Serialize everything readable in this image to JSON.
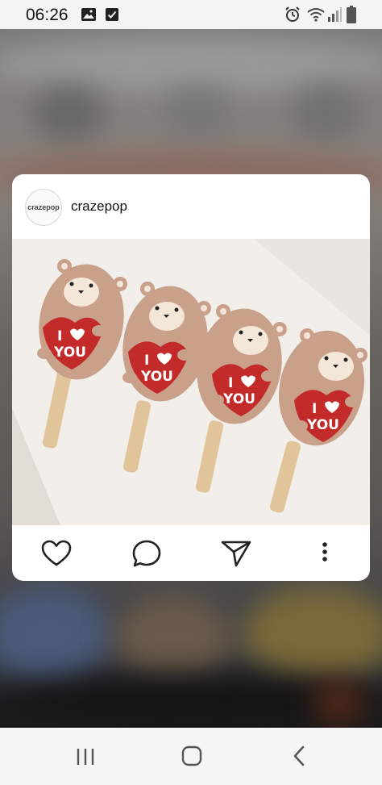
{
  "status_bar": {
    "time": "06:26",
    "left_icons": [
      "image-icon",
      "checkbox-icon"
    ],
    "right_icons": [
      "alarm-icon",
      "wifi-icon",
      "signal-icon",
      "battery-icon"
    ]
  },
  "post": {
    "avatar_text": "crazepop",
    "username": "crazepop",
    "image_icon": "bear-cakesicles-photo",
    "actions": [
      "heart-icon",
      "comment-icon",
      "share-icon",
      "more-icon"
    ]
  },
  "popsicles": [
    {
      "top": "I",
      "bottom": "YOU"
    },
    {
      "top": "I",
      "bottom": "YOU"
    },
    {
      "top": "I",
      "bottom": "YOU"
    },
    {
      "top": "I",
      "bottom": "YOU"
    }
  ],
  "nav_bar": {
    "buttons": [
      "recent-apps-icon",
      "home-icon",
      "back-icon"
    ]
  },
  "colors": {
    "heart": "#c32a2a",
    "chocolate": "#c9a08a",
    "stick": "#e2c49a"
  }
}
